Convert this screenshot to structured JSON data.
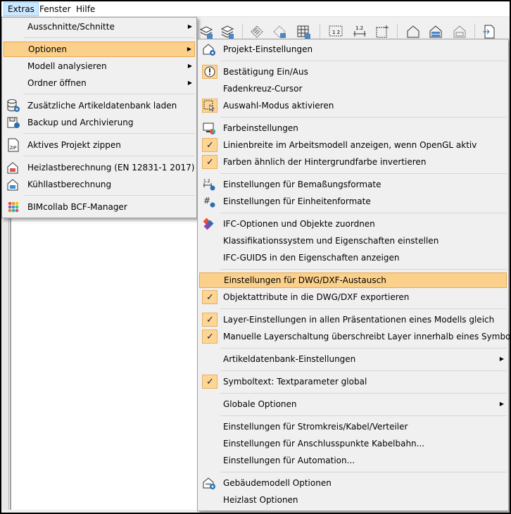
{
  "menubar": {
    "items": [
      "Extras",
      "Fenster",
      "Hilfe"
    ]
  },
  "extras_menu": {
    "items": [
      {
        "label": "Ausschnitte/Schnitte",
        "submenu": true
      },
      {
        "label": "Optionen",
        "submenu": true,
        "highlighted": true
      },
      {
        "label": "Modell analysieren",
        "submenu": true
      },
      {
        "label": "Ordner öffnen",
        "submenu": true
      },
      {
        "label": "Zusätzliche Artikeldatenbank laden",
        "icon": "database-add-icon"
      },
      {
        "label": "Backup und Archivierung",
        "icon": "backup-icon"
      },
      {
        "label": "Aktives Projekt zippen",
        "icon": "zip-icon"
      },
      {
        "label": "Heizlastberechnung (EN 12831-1 2017)",
        "icon": "heating-load-icon"
      },
      {
        "label": "Kühllastberechnung",
        "icon": "cooling-load-icon"
      },
      {
        "label": "BIMcollab BCF-Manager",
        "icon": "bimcollab-icon"
      }
    ]
  },
  "options_menu": {
    "items": [
      {
        "label": "Projekt-Einstellungen",
        "icon": "project-settings-icon"
      },
      {
        "label": "Bestätigung Ein/Aus",
        "icon": "warning-toggle-icon",
        "checked_style": true
      },
      {
        "label": "Fadenkreuz-Cursor"
      },
      {
        "label": "Auswahl-Modus aktivieren",
        "icon": "selection-mode-icon",
        "checked_style": true
      },
      {
        "label": "Farbeinstellungen",
        "icon": "color-settings-icon"
      },
      {
        "label": "Linienbreite im Arbeitsmodell anzeigen, wenn OpenGL aktiv",
        "checked": true
      },
      {
        "label": "Farben ähnlich der Hintergrundfarbe invertieren",
        "checked": true
      },
      {
        "label": "Einstellungen für Bemaßungsformate",
        "icon": "dimension-format-icon"
      },
      {
        "label": "Einstellungen für Einheitenformate",
        "icon": "unit-format-icon"
      },
      {
        "label": "IFC-Optionen und Objekte zuordnen",
        "icon": "ifc-icon"
      },
      {
        "label": "Klassifikationssystem und Eigenschaften einstellen"
      },
      {
        "label": "IFC-GUIDS in den Eigenschaften anzeigen"
      },
      {
        "label": "Einstellungen für DWG/DXF-Austausch",
        "highlighted": true
      },
      {
        "label": "Objektattribute in die DWG/DXF exportieren",
        "checked": true
      },
      {
        "label": "Layer-Einstellungen in allen Präsentationen eines Modells gleich",
        "checked": true
      },
      {
        "label": "Manuelle Layerschaltung überschreibt Layer innerhalb eines Symbols",
        "checked": true
      },
      {
        "label": "Artikeldatenbank-Einstellungen",
        "submenu": true
      },
      {
        "label": "Symboltext: Textparameter global",
        "checked": true
      },
      {
        "label": "Globale Optionen",
        "submenu": true
      },
      {
        "label": "Einstellungen für Stromkreis/Kabel/Verteiler"
      },
      {
        "label": "Einstellungen für Anschlusspunkte Kabelbahn..."
      },
      {
        "label": "Einstellungen für Automation..."
      },
      {
        "label": "Gebäudemodell Optionen",
        "icon": "building-model-icon"
      },
      {
        "label": "Heizlast Optionen"
      }
    ]
  },
  "glyphs": {
    "submenu_arrow": "▶",
    "check": "✓"
  },
  "colors": {
    "highlight": "#fbd08b",
    "highlight_border": "#e8a850",
    "check_bg": "#fdd696",
    "menubar_active": "#cce8ff"
  }
}
